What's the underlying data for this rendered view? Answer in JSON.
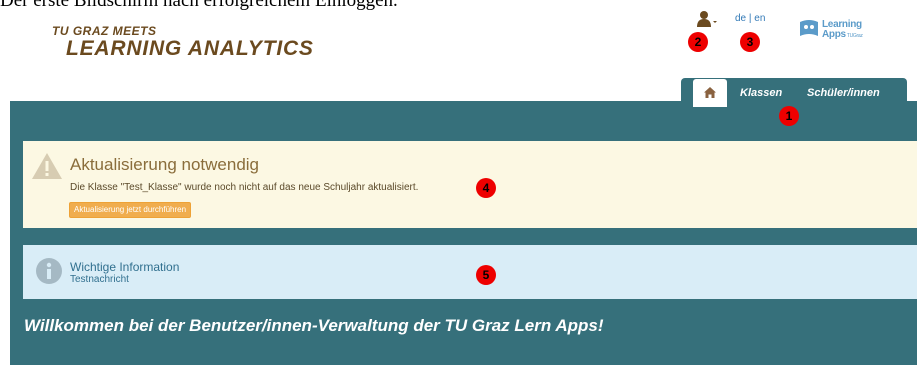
{
  "caption": "Der erste Bildschirm nach erfolgreichem Einloggen.",
  "logo": {
    "line1": "TU GRAZ MEETS",
    "line2": "LEARNING ANALYTICS"
  },
  "language": {
    "de": "de",
    "sep": " | ",
    "en": "en"
  },
  "partner_logo": {
    "line1": "Learning",
    "line2": "Apps",
    "sub": "TUGraz"
  },
  "tabs": {
    "home_icon": "home-icon",
    "klassen": "Klassen",
    "schueler": "Schüler/innen"
  },
  "warning": {
    "title": "Aktualisierung notwendig",
    "text": "Die Klasse \"Test_Klasse\" wurde noch nicht auf das neue Schuljahr aktualisiert.",
    "button": "Aktualisierung jetzt durchführen"
  },
  "info": {
    "title": "Wichtige Information",
    "text": "Testnachricht"
  },
  "welcome": "Willkommen bei der Benutzer/innen-Verwaltung der TU Graz Lern Apps!",
  "markers": [
    "1",
    "2",
    "3",
    "4",
    "5"
  ],
  "colors": {
    "band": "#36707b",
    "warning_bg": "#fcf8e3",
    "info_bg": "#d9edf7",
    "button": "#f0ad4e",
    "marker": "#ee0000"
  }
}
